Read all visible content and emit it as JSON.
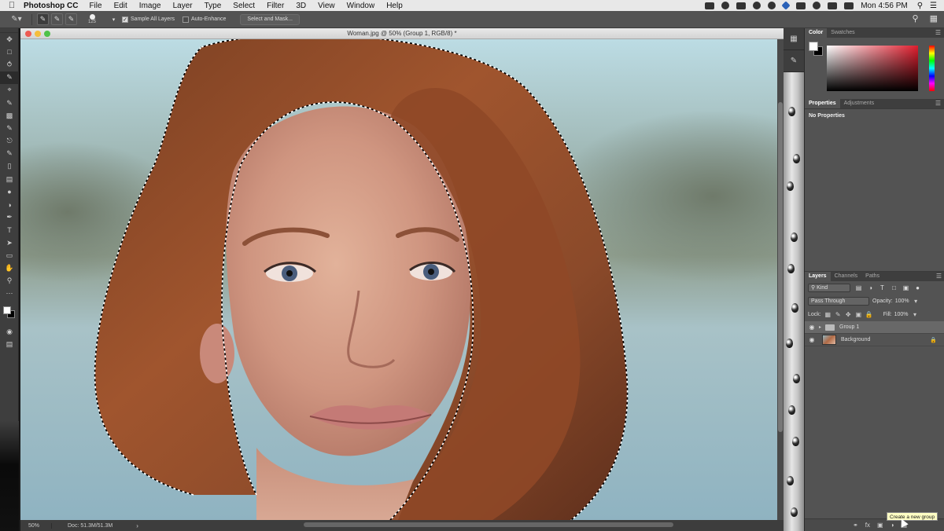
{
  "menubar": {
    "apple_icon": "",
    "app_name": "Photoshop CC",
    "items": [
      "File",
      "Edit",
      "Image",
      "Layer",
      "Type",
      "Select",
      "Filter",
      "3D",
      "View",
      "Window",
      "Help"
    ],
    "clock": "Mon 4:56 PM"
  },
  "options": {
    "brush_size": "125",
    "sample_all_layers_label": "Sample All Layers",
    "sample_all_layers_checked": true,
    "auto_enhance_label": "Auto-Enhance",
    "auto_enhance_checked": false,
    "select_and_mask_label": "Select and Mask..."
  },
  "document": {
    "title": "Woman.jpg @ 50% (Group 1, RGB/8) *",
    "zoom": "50%",
    "doc_size": "Doc: 51.3M/51.3M",
    "arrow": "›"
  },
  "panels": {
    "color_tabs": [
      "Color",
      "Swatches"
    ],
    "properties_tabs": [
      "Properties",
      "Adjustments"
    ],
    "no_properties": "No Properties",
    "layers_tabs": [
      "Layers",
      "Channels",
      "Paths"
    ],
    "filter_kind": "Kind",
    "blend_mode": "Pass Through",
    "opacity_label": "Opacity:",
    "opacity_value": "100%",
    "lock_label": "Lock:",
    "fill_label": "Fill:",
    "fill_value": "100%",
    "layers": [
      {
        "name": "Group 1",
        "type": "group",
        "selected": true
      },
      {
        "name": "Background",
        "type": "image",
        "locked": true
      }
    ],
    "footer_icons": [
      "link-icon",
      "fx-icon",
      "mask-icon",
      "adjustment-icon",
      "new-group-icon"
    ],
    "tooltip": "Create a new group"
  },
  "colors": {
    "accent": "#2a62b8",
    "panel_bg": "#535353",
    "toolbar_bg": "#3e3e3e"
  }
}
